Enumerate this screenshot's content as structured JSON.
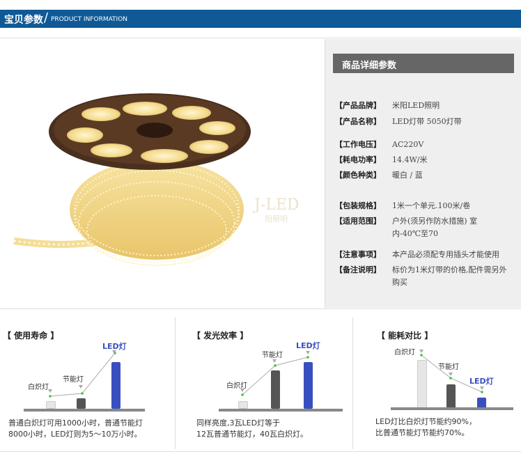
{
  "header": {
    "title_zh": "宝贝参数",
    "title_en": "PRODUCT INFORMATION"
  },
  "product_image": {
    "watermark": "J-LED",
    "watermark_sub": "阳照明"
  },
  "details": {
    "title": "商品详细参数",
    "specs": [
      {
        "key": "【产品品牌】",
        "value": "米阳LED照明"
      },
      {
        "key": "【产品名称】",
        "value": "LED灯带 5050灯带"
      },
      {
        "key": "【工作电压】",
        "value": "AC220V"
      },
      {
        "key": "【耗电功率】",
        "value": "14.4W/米"
      },
      {
        "key": "【颜色种类】",
        "value": "暖白  /  蓝"
      },
      {
        "key": "【包装规格】",
        "value": "1米一个单元.100米/卷"
      },
      {
        "key": "【适用范围】",
        "value": "户外(须另作防水措施) 室内-40℃至70"
      },
      {
        "key": "【注意事项】",
        "value": "本产品必须配专用插头才能使用"
      },
      {
        "key": "【备注说明】",
        "value": "标价为1米灯带的价格,配件需另外购买"
      }
    ]
  },
  "cards": [
    {
      "title": "【 使用寿命 】",
      "labels": {
        "a": "白炽灯",
        "b": "节能灯",
        "c": "LED灯"
      },
      "desc_line1": "普通白炽灯可用1000小时，普通节能灯",
      "desc_line2": "8000小时，LED灯则为5～10万小时。"
    },
    {
      "title": "【 发光效率 】",
      "labels": {
        "a": "白炽灯",
        "b": "节能灯",
        "c": "LED灯"
      },
      "desc_line1": "同样亮度,3瓦LED灯等于",
      "desc_line2": "12瓦普通节能灯，40瓦白炽灯。"
    },
    {
      "title": "【 能耗对比 】",
      "labels": {
        "a": "白炽灯",
        "b": "节能灯",
        "c": "LED灯"
      },
      "desc_line1": "LED灯比白炽灯节能约90%，",
      "desc_line2": "比普通节能灯节能约70%。"
    }
  ],
  "colors": {
    "header_bg": "#0f5a96",
    "led_blue": "#3a4fbf",
    "cfl_dark": "#555555",
    "bulb_light": "#e6e6e6",
    "panel_bg": "#efefef"
  }
}
